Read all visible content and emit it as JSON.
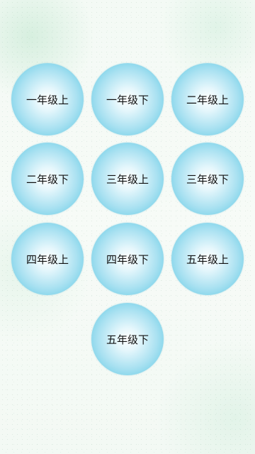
{
  "grades": [
    {
      "label": "一年级上"
    },
    {
      "label": "一年级下"
    },
    {
      "label": "二年级上"
    },
    {
      "label": "二年级下"
    },
    {
      "label": "三年级上"
    },
    {
      "label": "三年级下"
    },
    {
      "label": "四年级上"
    },
    {
      "label": "四年级下"
    },
    {
      "label": "五年级上"
    },
    {
      "label": "五年级下"
    }
  ],
  "colors": {
    "button_center": "#ffffff",
    "button_edge": "#5ec6e2",
    "background": "#f4faf5",
    "text": "#111111"
  }
}
